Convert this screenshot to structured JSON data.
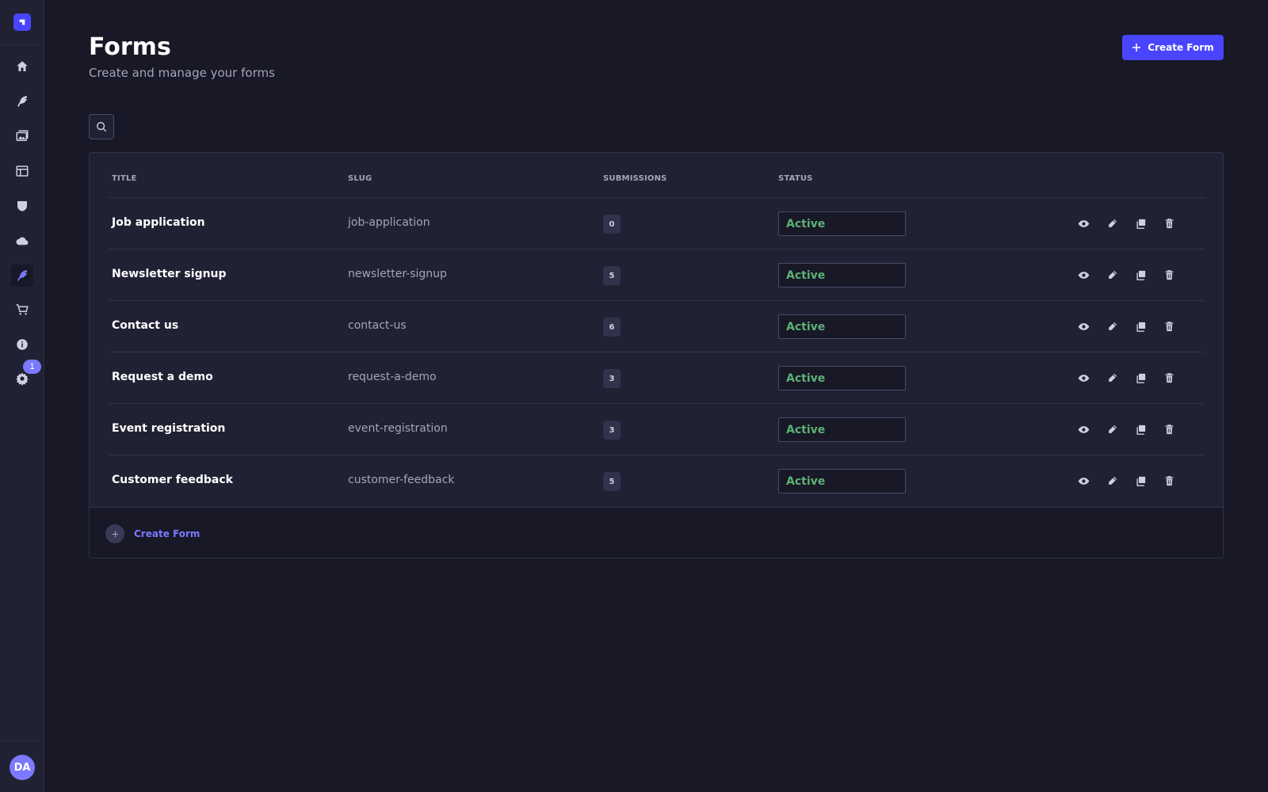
{
  "sidebar": {
    "items": [
      {
        "name": "home-icon"
      },
      {
        "name": "feather-icon"
      },
      {
        "name": "media-library-icon"
      },
      {
        "name": "layout-icon"
      },
      {
        "name": "shield-icon"
      },
      {
        "name": "cloud-icon"
      },
      {
        "name": "forms-feather-icon",
        "active": true
      },
      {
        "name": "cart-icon"
      },
      {
        "name": "info-icon"
      },
      {
        "name": "gear-icon"
      }
    ],
    "settings_badge": "1",
    "avatar_initials": "DA"
  },
  "header": {
    "title": "Forms",
    "subtitle": "Create and manage your forms",
    "create_button": "Create Form"
  },
  "table": {
    "columns": [
      "TITLE",
      "SLUG",
      "SUBMISSIONS",
      "STATUS"
    ],
    "rows": [
      {
        "title": "Job application",
        "slug": "job-application",
        "submissions": "0",
        "status": "Active"
      },
      {
        "title": "Newsletter signup",
        "slug": "newsletter-signup",
        "submissions": "5",
        "status": "Active"
      },
      {
        "title": "Contact us",
        "slug": "contact-us",
        "submissions": "6",
        "status": "Active"
      },
      {
        "title": "Request a demo",
        "slug": "request-a-demo",
        "submissions": "3",
        "status": "Active"
      },
      {
        "title": "Event registration",
        "slug": "event-registration",
        "submissions": "3",
        "status": "Active"
      },
      {
        "title": "Customer feedback",
        "slug": "customer-feedback",
        "submissions": "5",
        "status": "Active"
      }
    ],
    "footer_create": "Create Form"
  },
  "colors": {
    "accent": "#4945ff",
    "active_status": "#5cb176",
    "background": "#181826",
    "panel": "#212134"
  }
}
